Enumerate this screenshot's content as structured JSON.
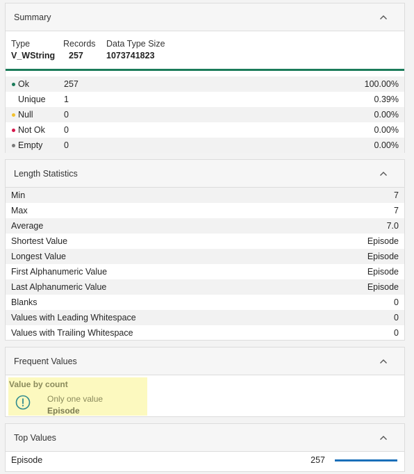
{
  "summary": {
    "title": "Summary",
    "type_label": "Type",
    "type_value": "V_WString",
    "records_label": "Records",
    "records_value": "257",
    "size_label": "Data Type Size",
    "size_value": "1073741823",
    "rows": [
      {
        "name": "Ok",
        "count": "257",
        "pct": "100.00%",
        "dot_color": "#1b7b5a"
      },
      {
        "name": "Unique",
        "count": "1",
        "pct": "0.39%"
      },
      {
        "name": "Null",
        "count": "0",
        "pct": "0.00%",
        "dot_color": "#f2c12e"
      },
      {
        "name": "Not Ok",
        "count": "0",
        "pct": "0.00%",
        "dot_color": "#d6184b"
      },
      {
        "name": "Empty",
        "count": "0",
        "pct": "0.00%",
        "dot_color": "#7a7a7a"
      }
    ]
  },
  "length": {
    "title": "Length Statistics",
    "rows": [
      {
        "label": "Min",
        "value": "7"
      },
      {
        "label": "Max",
        "value": "7"
      },
      {
        "label": "Average",
        "value": "7.0"
      },
      {
        "label": "Shortest Value",
        "value": "Episode"
      },
      {
        "label": "Longest Value",
        "value": "Episode"
      },
      {
        "label": "First Alphanumeric Value",
        "value": "Episode"
      },
      {
        "label": "Last Alphanumeric Value",
        "value": "Episode"
      },
      {
        "label": "Blanks",
        "value": "0"
      },
      {
        "label": "Values with Leading Whitespace",
        "value": "0"
      },
      {
        "label": "Values with Trailing Whitespace",
        "value": "0"
      }
    ]
  },
  "frequent": {
    "title": "Frequent Values",
    "box_title": "Value by count",
    "message": "Only one value",
    "value": "Episode",
    "icon": "exclamation-circle-icon"
  },
  "top": {
    "title": "Top Values",
    "rows": [
      {
        "name": "Episode",
        "count": "257",
        "fraction": 1.0
      }
    ]
  },
  "colors": {
    "ok": "#1b7b5a",
    "null": "#f2c12e",
    "not_ok": "#d6184b",
    "empty": "#7a7a7a",
    "bar": "#1a6fb9",
    "highlight": "#fcf9bf"
  },
  "icons": {
    "collapse": "chevron-up-icon"
  }
}
